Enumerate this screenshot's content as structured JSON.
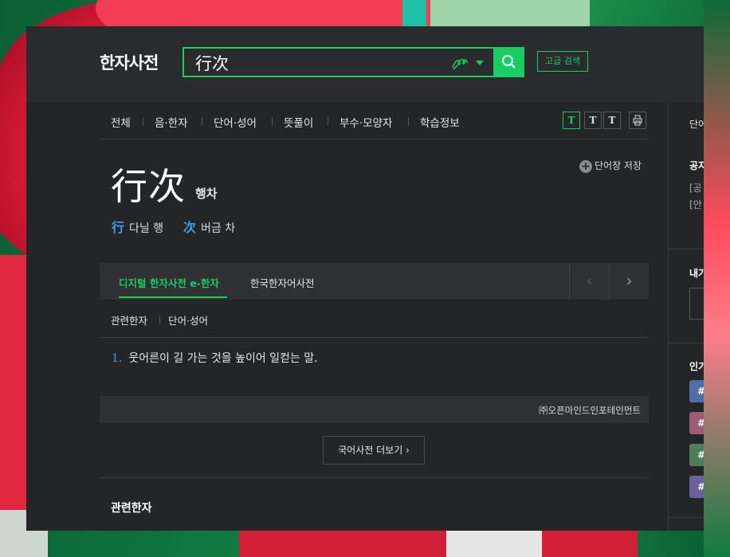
{
  "header": {
    "logo": "한자사전",
    "search_value": "行次",
    "advanced_label": "고급 검색",
    "accent": "#19ce60"
  },
  "tabs": [
    "전체",
    "음·한자",
    "단어·성어",
    "뜻풀이",
    "부수·모양자",
    "학습정보"
  ],
  "font_buttons": [
    "T",
    "T",
    "T"
  ],
  "entry": {
    "word": "行次",
    "reading": "행차",
    "save_label": "단어장 저장",
    "hanja": [
      {
        "char": "行",
        "meaning": "다닐 행"
      },
      {
        "char": "次",
        "meaning": "버금 차"
      }
    ]
  },
  "dict_tabs": {
    "active": "디지털 한자사전 e-한자",
    "other": "한국한자어사전",
    "prev": "‹",
    "next": "›"
  },
  "sub_tabs": [
    "관련한자",
    "단어·성어"
  ],
  "definition": {
    "number": "1.",
    "text": "웃어른이 길 가는 것을 높이어 일컫는 말."
  },
  "source": "㈜오픈마인드인포테인먼트",
  "more_label": "국어사전 더보기 ›",
  "related_title": "관련한자",
  "sidebar": {
    "top": "단어",
    "section1_title": "공지",
    "section1_items": [
      "[공",
      "[안"
    ],
    "section2_title": "내가",
    "section3_title": "인기",
    "tags": [
      {
        "label": "#",
        "color": "#4f6fa8"
      },
      {
        "label": "#",
        "color": "#9a5c78"
      },
      {
        "label": "#",
        "color": "#4c7e5a"
      },
      {
        "label": "#",
        "color": "#6b5f9e"
      }
    ]
  }
}
